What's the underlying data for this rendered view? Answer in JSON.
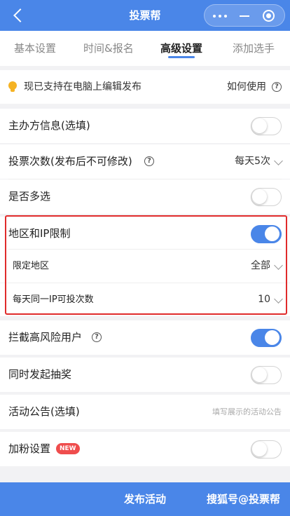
{
  "header": {
    "title": "投票帮"
  },
  "tabs": [
    {
      "label": "基本设置",
      "active": false
    },
    {
      "label": "时间&报名",
      "active": false
    },
    {
      "label": "高级设置",
      "active": true
    },
    {
      "label": "添加选手",
      "active": false
    }
  ],
  "tip": {
    "text": "现已支持在电脑上编辑发布",
    "link": "如何使用"
  },
  "settings": {
    "organizer": {
      "label": "主办方信息(选填)",
      "enabled": false
    },
    "vote_count": {
      "label": "投票次数(发布后不可修改)",
      "value": "每天5次"
    },
    "multi_select": {
      "label": "是否多选",
      "enabled": false
    },
    "region_ip": {
      "label": "地区和IP限制",
      "enabled": true
    },
    "region_limit": {
      "label": "限定地区",
      "value": "全部"
    },
    "ip_daily": {
      "label": "每天同一IP可投次数",
      "value": "10"
    },
    "block_risky": {
      "label": "拦截高风险用户",
      "enabled": true
    },
    "lottery": {
      "label": "同时发起抽奖",
      "enabled": false
    },
    "announcement": {
      "label": "活动公告(选填)",
      "placeholder": "填写展示的活动公告"
    },
    "fans": {
      "label": "加粉设置",
      "badge": "NEW",
      "enabled": false
    }
  },
  "footer": {
    "publish_label": "发布活动",
    "watermark": "搜狐号@投票帮"
  },
  "colors": {
    "brand": "#4a86e8",
    "highlight": "#e02b2b",
    "badge": "#ef4d4d"
  }
}
